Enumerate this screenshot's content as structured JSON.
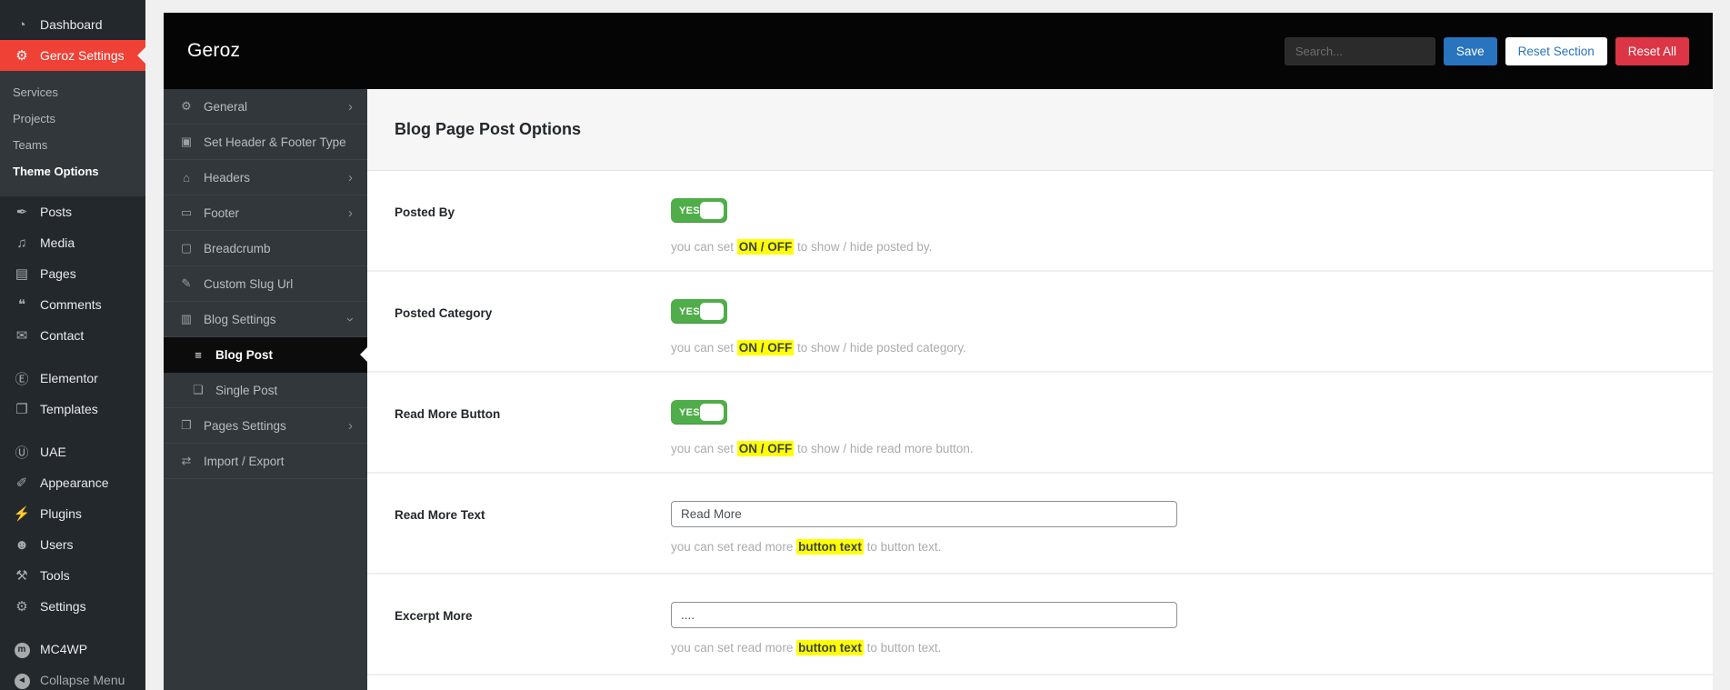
{
  "colors": {
    "accent_red": "#ef4136",
    "primary_blue": "#2874be",
    "danger_red": "#dc3545",
    "toggle_green": "#4fae49",
    "highlight_yellow": "#ffff00",
    "admin_sidebar_bg": "#23282d",
    "panel_header_bg": "#050505",
    "options_nav_bg": "#32373c"
  },
  "icons": {
    "dashboard": "◔",
    "gear": "⚙",
    "pin": "✒",
    "media": "♫",
    "pages": "▤",
    "comment": "❝",
    "envelope": "✉",
    "elementor": "Ⓔ",
    "folder": "❐",
    "uae": "Ⓤ",
    "brush": "✐",
    "plug": "⚡",
    "user": "☻",
    "tools": "⚒",
    "sliders": "⚙",
    "mc4wp": "m",
    "collapse": "◄",
    "header-footer": "▣",
    "home": "⌂",
    "footer": "▭",
    "breadcrumb": "▢",
    "edit": "✎",
    "book": "▥",
    "list": "≡",
    "doc": "❏",
    "copy": "❐",
    "import-export": "⇄",
    "chevron": "›"
  },
  "wp_sidebar": {
    "items": [
      {
        "label": "Dashboard",
        "icon": "dashboard"
      },
      {
        "label": "Geroz Settings",
        "icon": "gear",
        "active": true,
        "submenu": [
          {
            "label": "Services"
          },
          {
            "label": "Projects"
          },
          {
            "label": "Teams"
          },
          {
            "label": "Theme Options",
            "current": true
          }
        ]
      },
      {
        "label": "Posts",
        "icon": "pin"
      },
      {
        "label": "Media",
        "icon": "media"
      },
      {
        "label": "Pages",
        "icon": "pages"
      },
      {
        "label": "Comments",
        "icon": "comment"
      },
      {
        "label": "Contact",
        "icon": "envelope"
      },
      {
        "label": "Elementor",
        "icon": "elementor",
        "gap_before": true
      },
      {
        "label": "Templates",
        "icon": "folder"
      },
      {
        "label": "UAE",
        "icon": "uae",
        "gap_before": true
      },
      {
        "label": "Appearance",
        "icon": "brush"
      },
      {
        "label": "Plugins",
        "icon": "plug"
      },
      {
        "label": "Users",
        "icon": "user"
      },
      {
        "label": "Tools",
        "icon": "tools"
      },
      {
        "label": "Settings",
        "icon": "sliders"
      },
      {
        "label": "MC4WP",
        "icon": "mc4wp",
        "circle": true,
        "gap_before": true
      },
      {
        "label": "Collapse Menu",
        "icon": "collapse",
        "circle": true,
        "muted": true
      }
    ]
  },
  "topbar": {
    "logo": "Geroz",
    "search_placeholder": "Search...",
    "save_label": "Save",
    "reset_section_label": "Reset Section",
    "reset_all_label": "Reset All"
  },
  "options_nav": {
    "items": [
      {
        "label": "General",
        "icon": "gear",
        "chevron": "right"
      },
      {
        "label": "Set Header & Footer Type",
        "icon": "header-footer"
      },
      {
        "label": "Headers",
        "icon": "home",
        "chevron": "right"
      },
      {
        "label": "Footer",
        "icon": "footer",
        "chevron": "right"
      },
      {
        "label": "Breadcrumb",
        "icon": "breadcrumb"
      },
      {
        "label": "Custom Slug Url",
        "icon": "edit"
      },
      {
        "label": "Blog Settings",
        "icon": "book",
        "chevron": "down"
      },
      {
        "label": "Blog Post",
        "icon": "list",
        "active": true,
        "sub": true
      },
      {
        "label": "Single Post",
        "icon": "doc",
        "sub": true
      },
      {
        "label": "Pages Settings",
        "icon": "copy",
        "chevron": "right"
      },
      {
        "label": "Import / Export",
        "icon": "import-export"
      }
    ]
  },
  "content": {
    "title": "Blog Page Post Options",
    "rows": [
      {
        "label": "Posted By",
        "control": "toggle",
        "toggle_label": "YES",
        "desc": [
          "you can set ",
          "ON / OFF",
          " to show / hide posted by."
        ]
      },
      {
        "label": "Posted Category",
        "control": "toggle",
        "toggle_label": "YES",
        "desc": [
          "you can set ",
          "ON / OFF",
          " to show / hide posted category."
        ]
      },
      {
        "label": "Read More Button",
        "control": "toggle",
        "toggle_label": "YES",
        "desc": [
          "you can set ",
          "ON / OFF",
          " to show / hide read more button."
        ]
      },
      {
        "label": "Read More Text",
        "control": "input",
        "value": "Read More",
        "desc": [
          "you can set read more ",
          "button text",
          " to button text."
        ]
      },
      {
        "label": "Excerpt More",
        "control": "input",
        "value": "....",
        "desc": [
          "you can set read more ",
          "button text",
          " to button text."
        ]
      }
    ]
  }
}
